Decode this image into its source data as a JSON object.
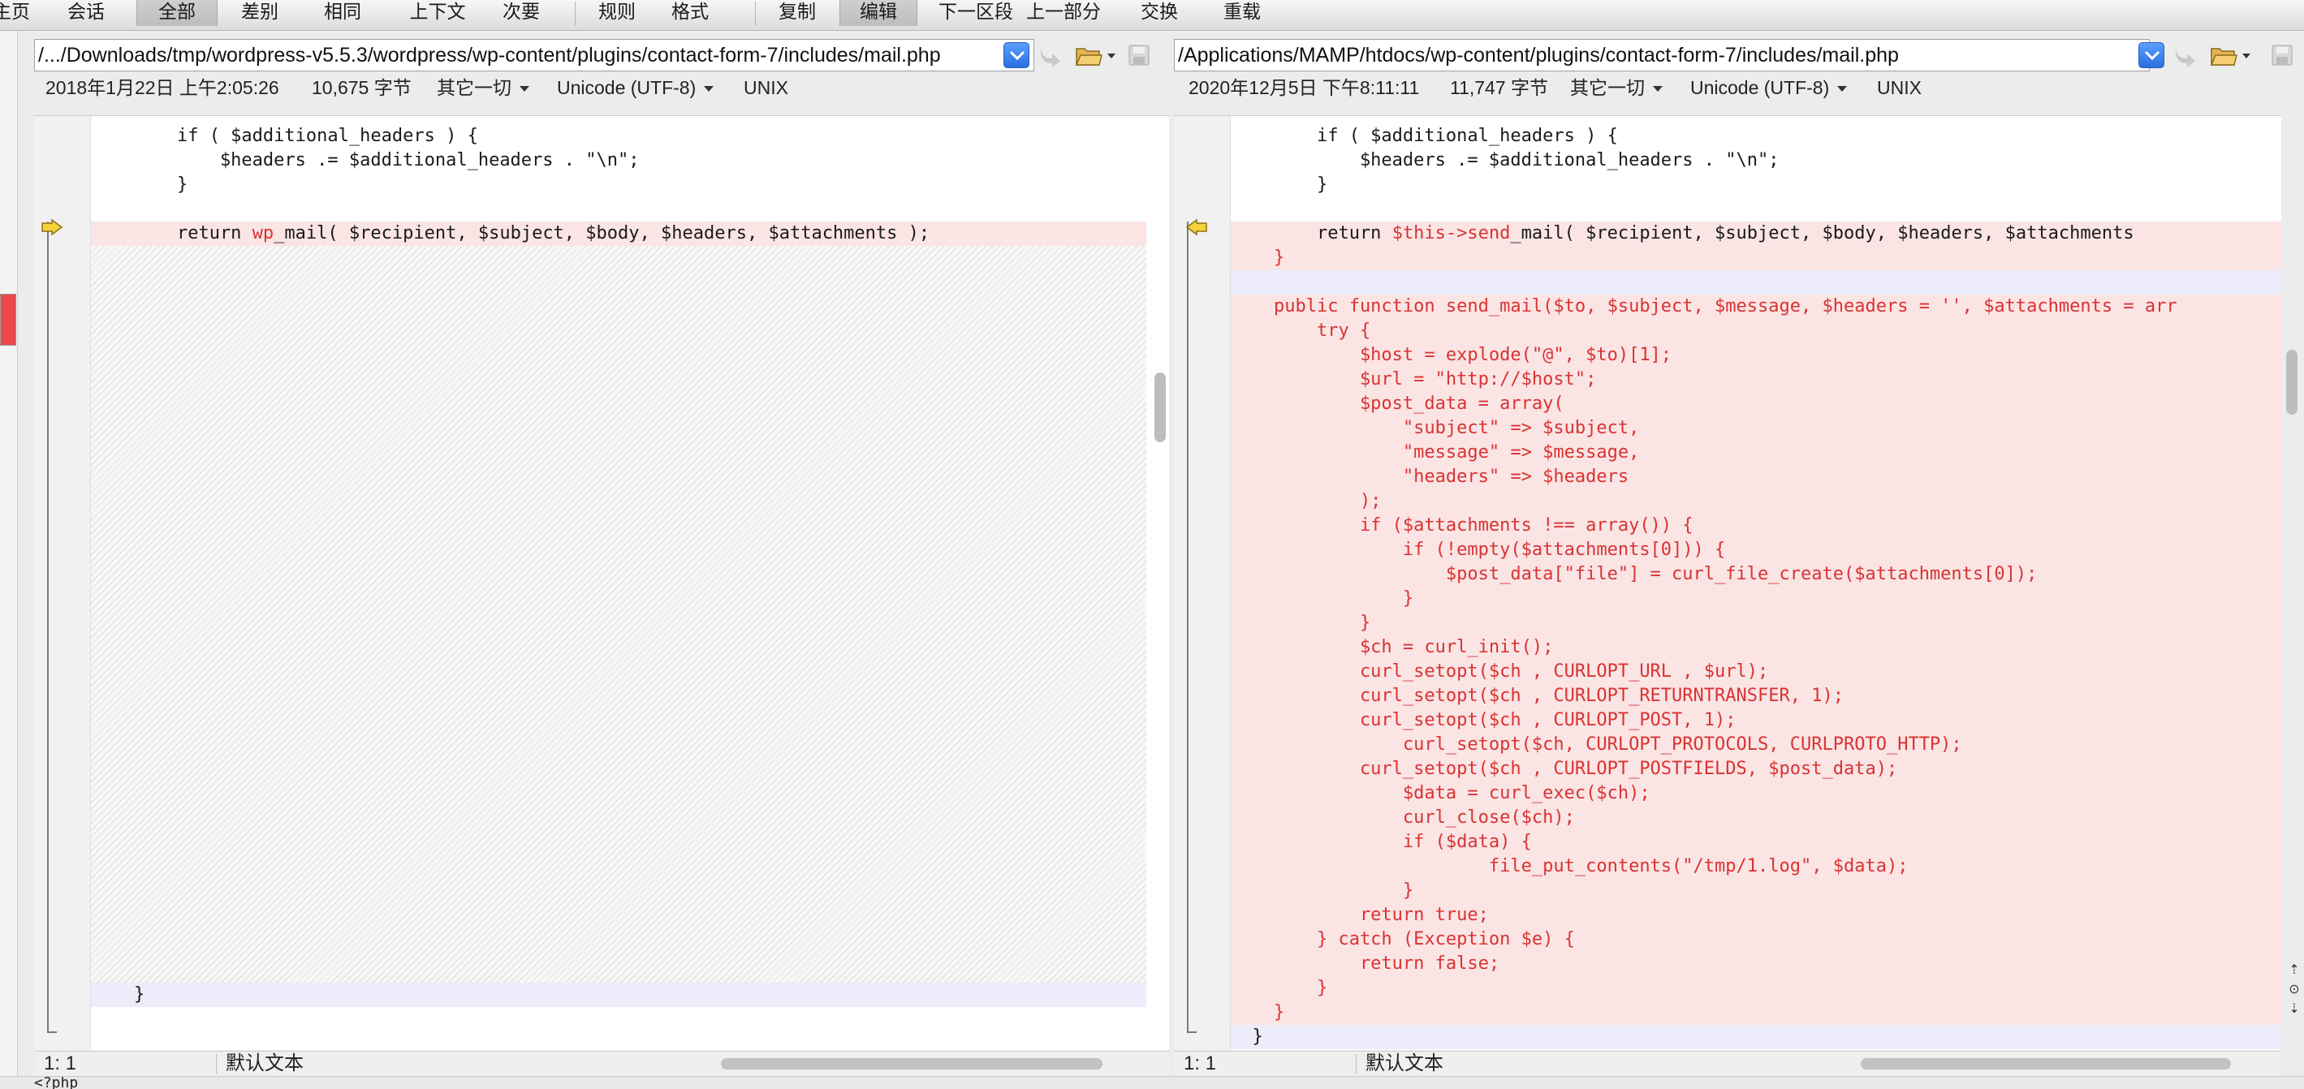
{
  "toolbar": {
    "items": [
      {
        "label": "主页"
      },
      {
        "label": "会话"
      },
      {
        "label": "全部"
      },
      {
        "label": "差别"
      },
      {
        "label": "相同"
      },
      {
        "label": "上下文"
      },
      {
        "label": "次要"
      },
      {
        "label": "规则"
      },
      {
        "label": "格式"
      },
      {
        "label": "复制"
      },
      {
        "label": "编辑"
      },
      {
        "label": "下一区段"
      },
      {
        "label": "上一部分"
      },
      {
        "label": "交换"
      },
      {
        "label": "重载"
      }
    ]
  },
  "left": {
    "path": "/.../Downloads/tmp/wordpress-v5.5.3/wordpress/wp-content/plugins/contact-form-7/includes/mail.php",
    "date": "2018年1月22日 上午2:05:26",
    "size": "10,675 字节",
    "line_endings_menu": "其它一切",
    "encoding": "Unicode (UTF-8)",
    "format": "UNIX",
    "lines": [
      "\t\tif ( $additional_headers ) {",
      "\t\t\t$headers .= $additional_headers . \"\\n\";",
      "\t\t}",
      "",
      "",
      "",
      "",
      "",
      "",
      "",
      "",
      "",
      "",
      "",
      "",
      "",
      "",
      "",
      "",
      "",
      "",
      "",
      "",
      "",
      "",
      "",
      "",
      "",
      "",
      "",
      "",
      "",
      "",
      "",
      "",
      "\t}",
      ""
    ],
    "diff_line": {
      "pre": "\t\treturn ",
      "hl": "wp",
      "post": "_mail( $recipient, $subject, $body, $headers, $attachments );"
    },
    "status_position": "1: 1",
    "status_mode": "默认文本"
  },
  "right": {
    "path": "/Applications/MAMP/htdocs/wp-content/plugins/contact-form-7/includes/mail.php",
    "date": "2020年12月5日 下午8:11:11",
    "size": "11,747 字节",
    "line_endings_menu": "其它一切",
    "encoding": "Unicode (UTF-8)",
    "format": "UNIX",
    "lines": [
      "\t\tif ( $additional_headers ) {",
      "\t\t\t$headers .= $additional_headers . \"\\n\";",
      "\t\t}",
      "",
      "\t\treturn $this->send_mail( $recipient, $subject, $body, $headers, $attachments",
      "\t}",
      "",
      "\tpublic function send_mail($to, $subject, $message, $headers = '', $attachments = arr",
      "\t    try {",
      "\t        $host = explode(\"@\", $to)[1];",
      "\t        $url = \"http://$host\";",
      "\t        $post_data = array(",
      "\t            \"subject\" => $subject,",
      "\t            \"message\" => $message,",
      "\t            \"headers\" => $headers",
      "\t        );",
      "\t        if ($attachments !== array()) {",
      "\t            if (!empty($attachments[0])) {",
      "\t                $post_data[\"file\"] = curl_file_create($attachments[0]);",
      "\t            }",
      "\t        }",
      "\t        $ch = curl_init();",
      "\t        curl_setopt($ch , CURLOPT_URL , $url);",
      "\t        curl_setopt($ch , CURLOPT_RETURNTRANSFER, 1);",
      "\t        curl_setopt($ch , CURLOPT_POST, 1);",
      "\t\t\t\tcurl_setopt($ch, CURLOPT_PROTOCOLS, CURLPROTO_HTTP);",
      "\t        curl_setopt($ch , CURLOPT_POSTFIELDS, $post_data);",
      "\t\t\t\t$data = curl_exec($ch);",
      "\t\t\t\tcurl_close($ch);",
      "\t\t\t\tif ($data) {",
      "\t\t\t\t\t\tfile_put_contents(\"/tmp/1.log\", $data);",
      "\t\t\t\t}",
      "\t        return true;",
      "\t    } catch (Exception $e) {",
      "\t        return false;",
      "\t    }",
      "\t}",
      ""
    ],
    "status_position": "1: 1",
    "status_mode": "默认文本"
  },
  "bottom_strip": "<?php"
}
